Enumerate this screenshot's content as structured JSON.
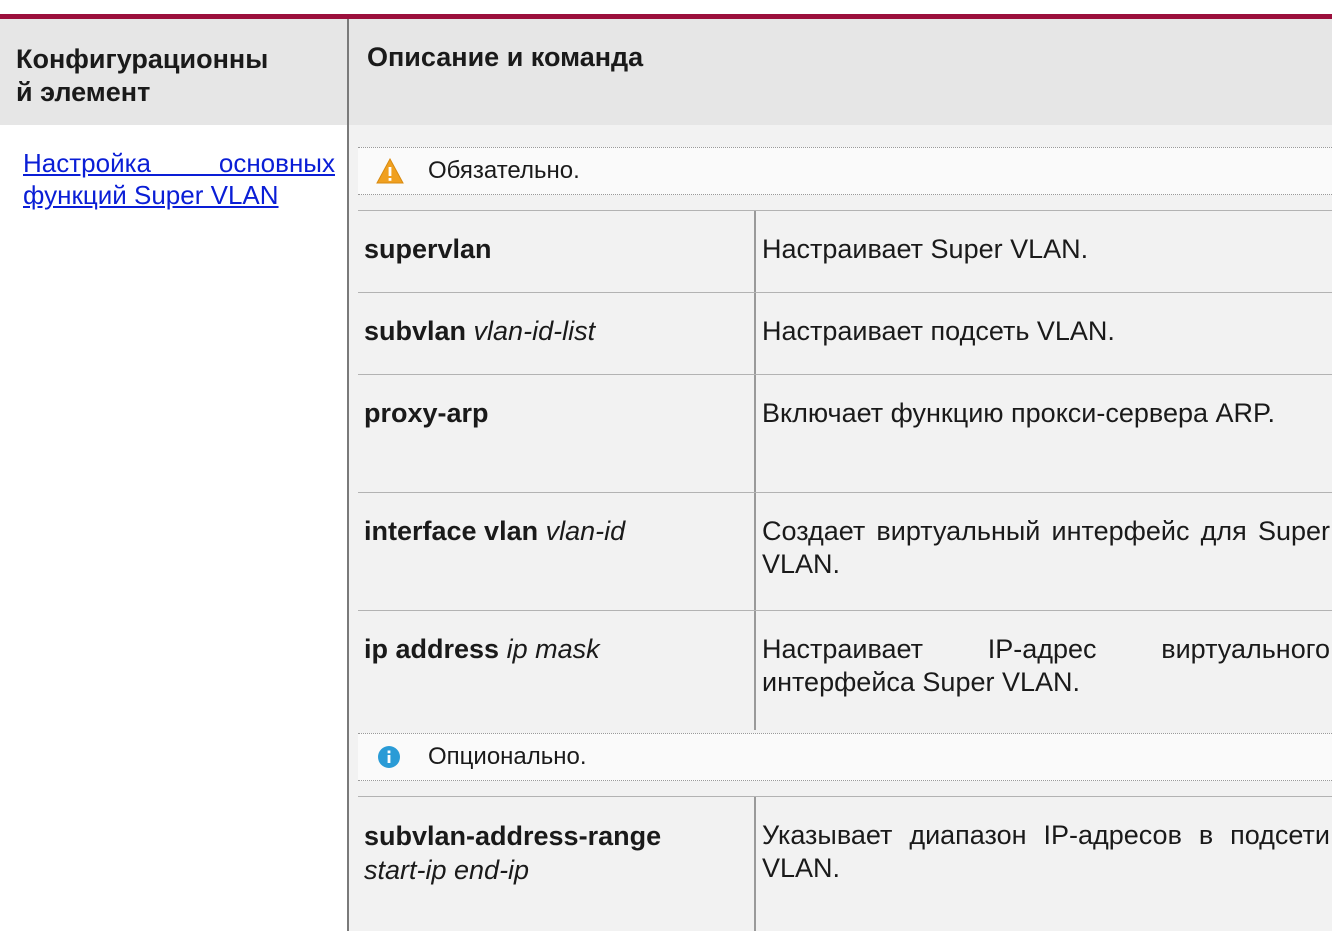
{
  "header": {
    "col1": "Конфигурационны\nй элемент",
    "col2": "Описание и команда"
  },
  "left_link": "Настройка основных функций Super VLAN",
  "required_note": "Обязательно.",
  "optional_note": "Опционально.",
  "required_rows": [
    {
      "cmd": "supervlan",
      "arg": "",
      "desc": "Настраивает Super VLAN."
    },
    {
      "cmd": "subvlan",
      "arg": "vlan-id-list",
      "desc": "Настраивает подсеть VLAN."
    },
    {
      "cmd": "proxy-arp",
      "arg": "",
      "desc": "Включает функцию прокси-сервера ARP."
    },
    {
      "cmd": "interface vlan",
      "arg": "vlan-id",
      "desc": "Создает виртуальный интерфейс для Super VLAN."
    },
    {
      "cmd": "ip address",
      "arg": "ip mask",
      "desc": "Настраивает IP-адрес виртуального интерфейса Super VLAN."
    }
  ],
  "optional_rows": [
    {
      "cmd": "subvlan-address-range",
      "arg": "start-ip end-ip",
      "desc": "Указывает диапазон IP-адресов в подсети VLAN."
    }
  ],
  "colors": {
    "accent_bar": "#9b0f3c",
    "link": "#0a1ed6",
    "warning": "#f0a020",
    "info": "#2a9bd6"
  },
  "icons": {
    "required": "warning-icon",
    "optional": "info-icon"
  }
}
